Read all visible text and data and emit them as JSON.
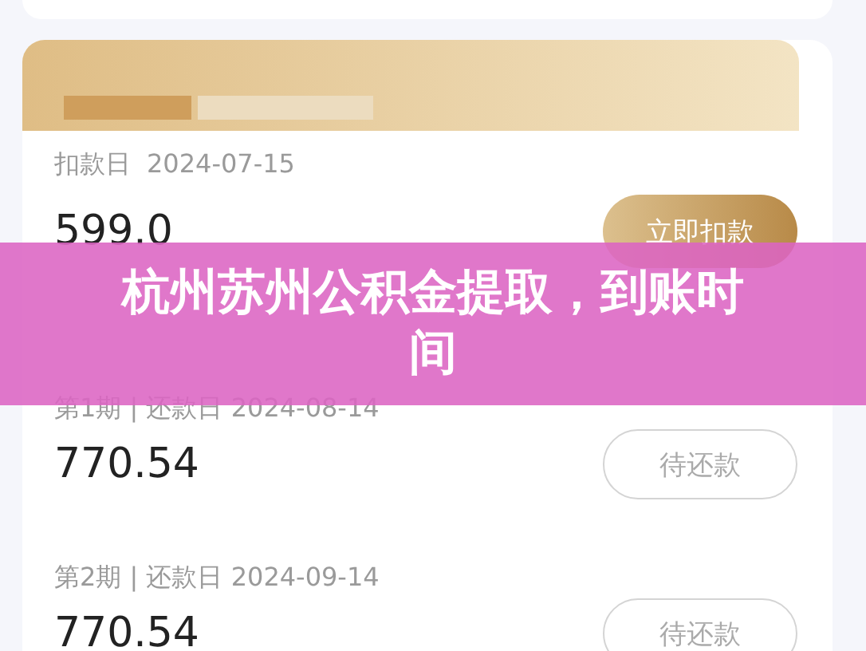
{
  "deduction": {
    "label": "扣款日",
    "date": "2024-07-15",
    "amount": "599.0",
    "button": "立即扣款"
  },
  "installments": [
    {
      "label": "第1期 | 还款日 2024-08-14",
      "amount": "770.54",
      "status": "待还款"
    },
    {
      "label": "第2期 | 还款日 2024-09-14",
      "amount": "770.54",
      "status": "待还款"
    }
  ],
  "banner": {
    "title": "杭州苏州公积金提取，到账时间"
  }
}
